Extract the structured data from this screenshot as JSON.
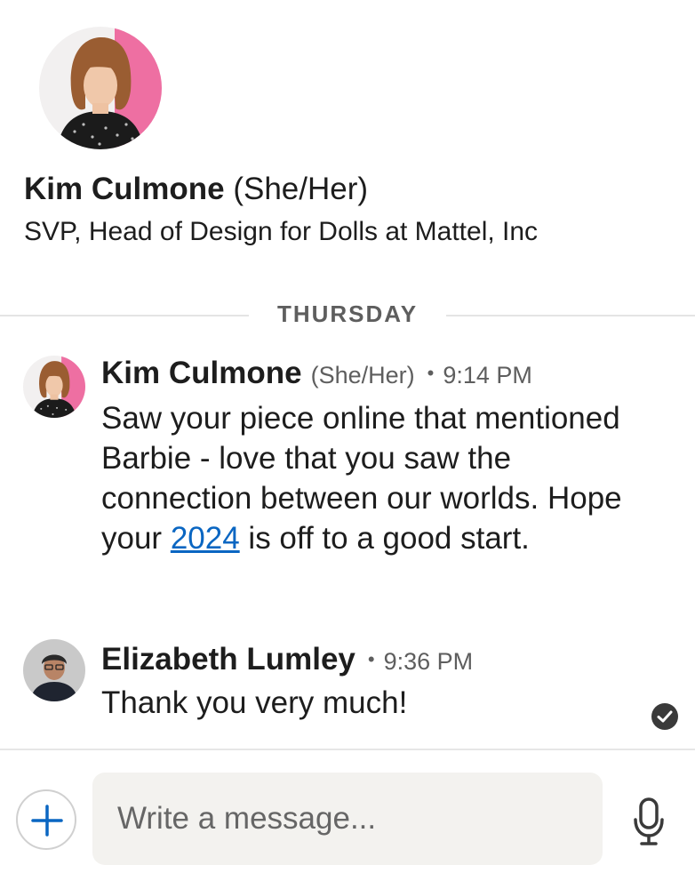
{
  "profile": {
    "name": "Kim Culmone",
    "pronouns": "(She/Her)",
    "headline": "SVP, Head of Design for Dolls at Mattel, Inc"
  },
  "divider": {
    "label": "THURSDAY"
  },
  "messages": [
    {
      "sender": "Kim Culmone",
      "pronouns": "(She/Her)",
      "separator": "•",
      "time": "9:14 PM",
      "text_before_link": "Saw your piece online that mentioned Barbie - love that you saw the connection between our worlds. Hope your ",
      "link": "2024",
      "text_after_link": " is off to a good start."
    },
    {
      "sender": "Elizabeth Lumley",
      "separator": "•",
      "time": "9:36 PM",
      "text": "Thank you very much!"
    }
  ],
  "composer": {
    "placeholder": "Write a message..."
  },
  "icons": {
    "read_receipt": "check-circle-icon",
    "add": "plus-icon",
    "voice": "microphone-icon"
  },
  "colors": {
    "link": "#0a66c2",
    "accent_plus": "#0a66c2",
    "input_bg": "#f3f2ef"
  }
}
